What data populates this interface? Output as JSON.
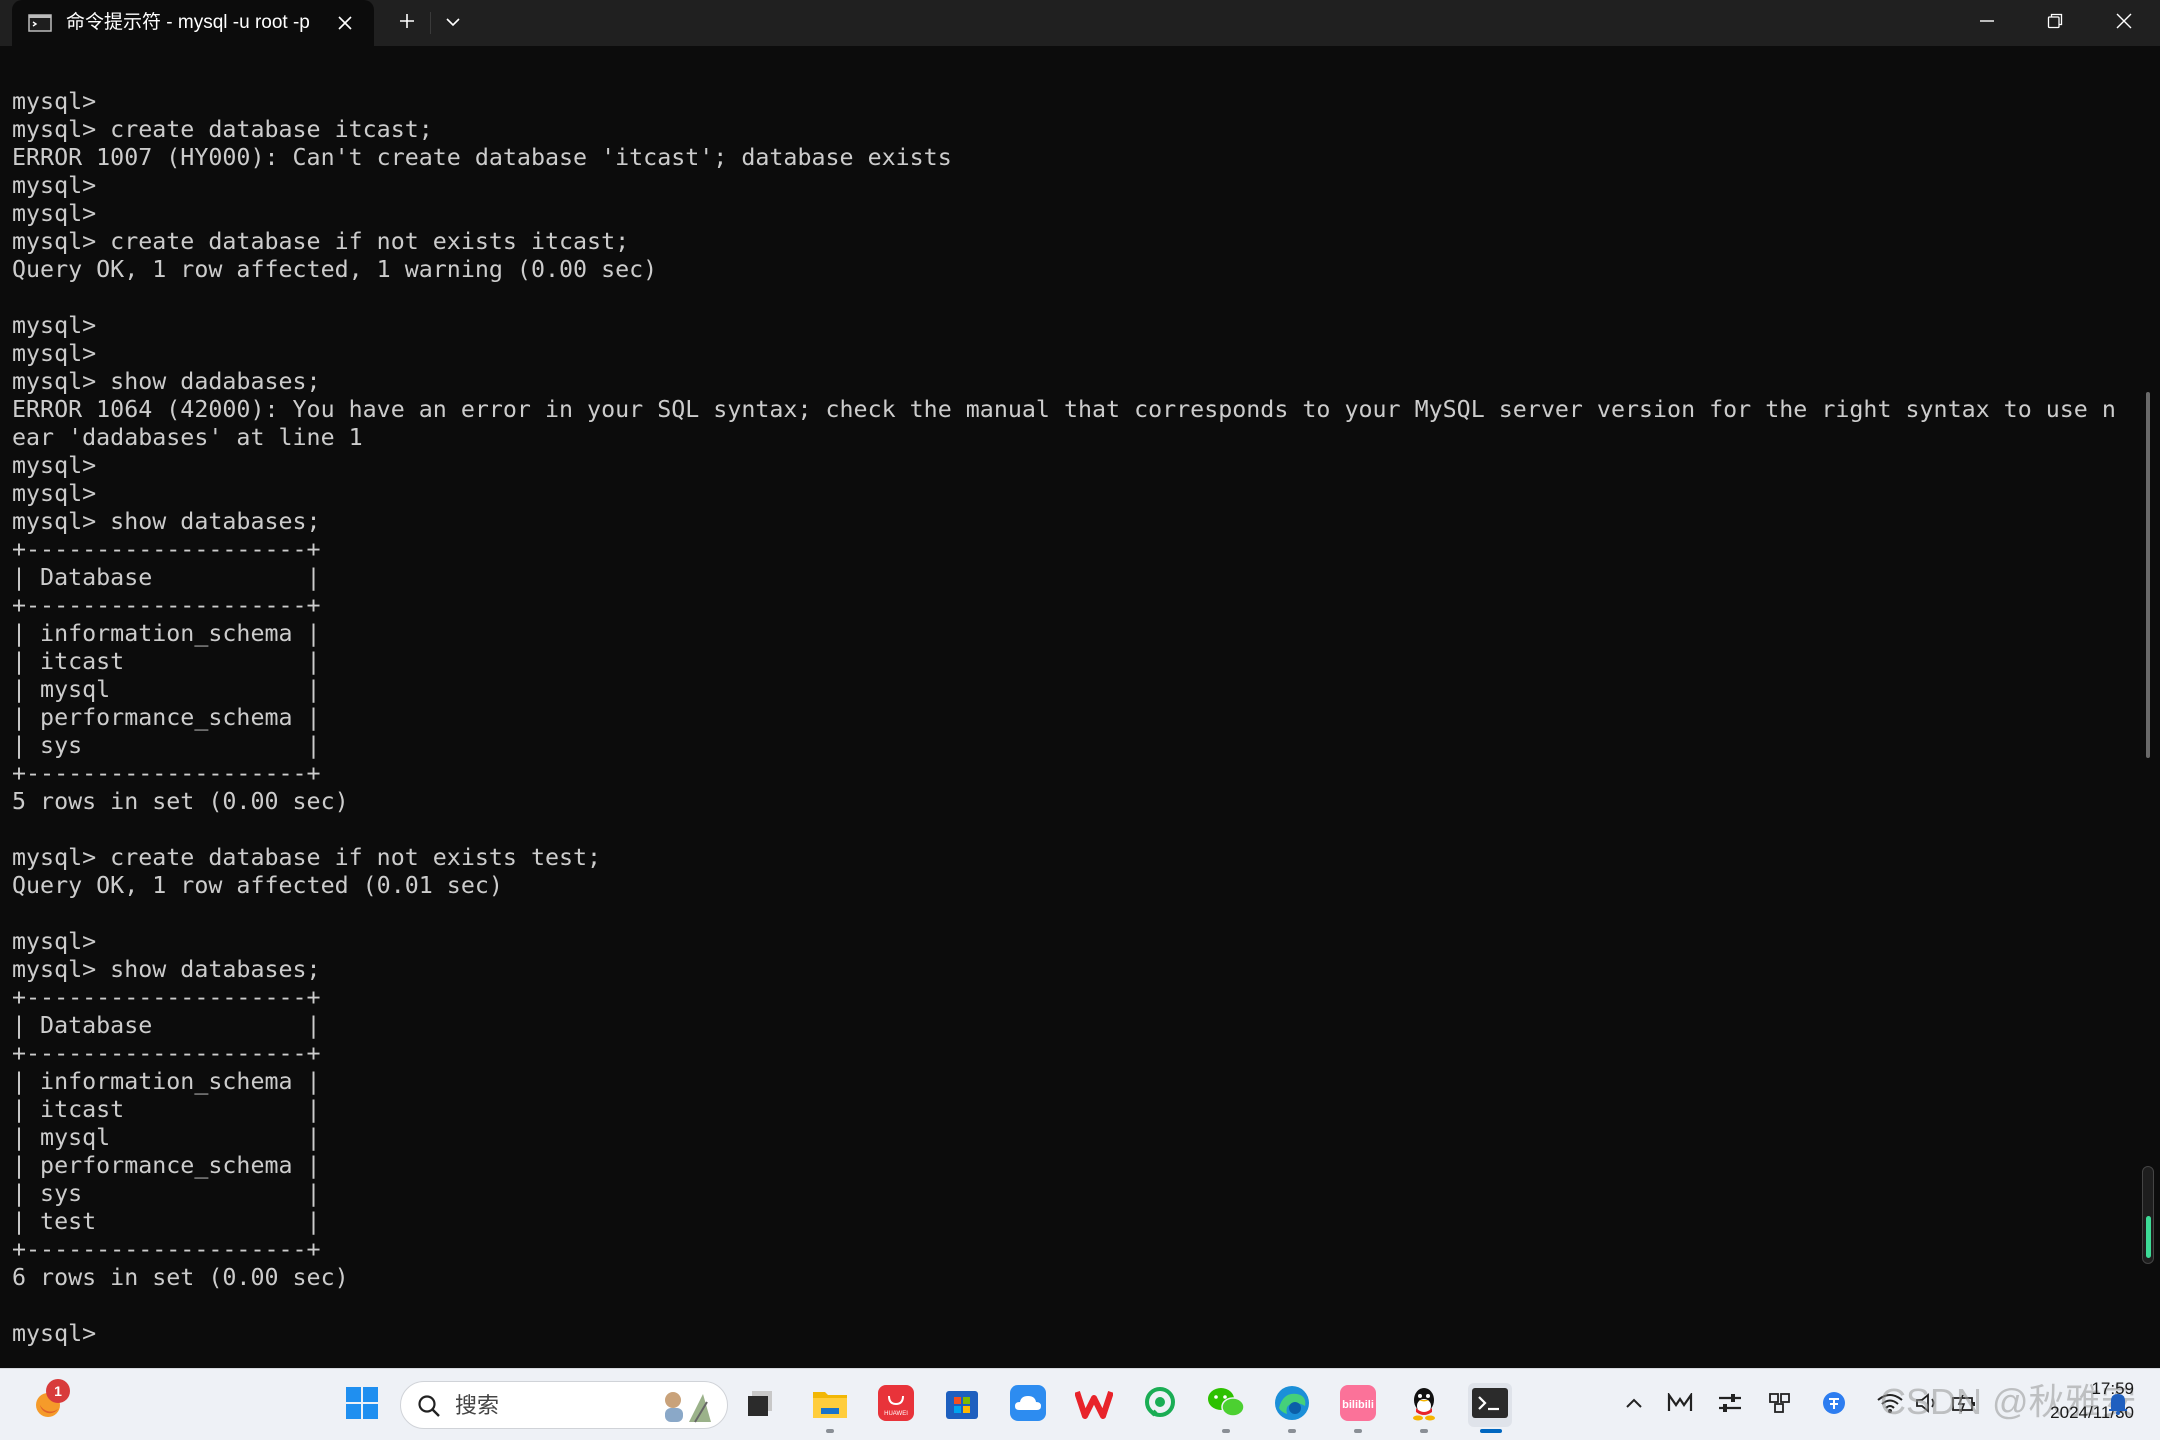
{
  "window": {
    "tab_title": "命令提示符 - mysql  -u root -p",
    "new_tab_icon": "plus-icon",
    "dropdown_icon": "chevron-down-icon",
    "controls": [
      "minimize-icon",
      "restore-icon",
      "close-icon"
    ]
  },
  "terminal": {
    "lines": [
      "mysql>",
      "mysql> create database itcast;",
      "ERROR 1007 (HY000): Can't create database 'itcast'; database exists",
      "mysql>",
      "mysql>",
      "mysql> create database if not exists itcast;",
      "Query OK, 1 row affected, 1 warning (0.00 sec)",
      "",
      "mysql>",
      "mysql>",
      "mysql> show dadabases;",
      "ERROR 1064 (42000): You have an error in your SQL syntax; check the manual that corresponds to your MySQL server version for the right syntax to use n",
      "ear 'dadabases' at line 1",
      "mysql>",
      "mysql>",
      "mysql> show databases;",
      "+--------------------+",
      "| Database           |",
      "+--------------------+",
      "| information_schema |",
      "| itcast             |",
      "| mysql              |",
      "| performance_schema |",
      "| sys                |",
      "+--------------------+",
      "5 rows in set (0.00 sec)",
      "",
      "mysql> create database if not exists test;",
      "Query OK, 1 row affected (0.01 sec)",
      "",
      "mysql>",
      "mysql> show databases;",
      "+--------------------+",
      "| Database           |",
      "+--------------------+",
      "| information_schema |",
      "| itcast             |",
      "| mysql              |",
      "| performance_schema |",
      "| sys                |",
      "| test               |",
      "+--------------------+",
      "6 rows in set (0.00 sec)",
      "",
      "mysql>"
    ],
    "colors": {
      "background": "#0c0c0c",
      "text": "#cccccc",
      "scroll_indicator": "#3ddc97"
    }
  },
  "taskbar": {
    "weather_badge": "1",
    "search_placeholder": "搜索",
    "apps": [
      {
        "name": "windows-start-icon"
      },
      {
        "name": "task-view-icon"
      },
      {
        "name": "file-explorer-icon"
      },
      {
        "name": "huawei-appgallery-icon",
        "label": "HUAWEI"
      },
      {
        "name": "microsoft-store-icon"
      },
      {
        "name": "cloud-drive-icon"
      },
      {
        "name": "wps-office-icon"
      },
      {
        "name": "green-chat-icon"
      },
      {
        "name": "wechat-icon"
      },
      {
        "name": "edge-browser-icon"
      },
      {
        "name": "bilibili-icon",
        "label": "bilibili"
      },
      {
        "name": "qq-icon"
      },
      {
        "name": "terminal-icon"
      }
    ],
    "tray": [
      "chevron-up-icon",
      "mail-icon",
      "sliders-icon",
      "blocks-icon",
      "ime-icon",
      "wifi-icon",
      "speaker-icon",
      "battery-icon",
      "notification-icon"
    ],
    "clock": {
      "time": "17:59",
      "date": "2024/11/30"
    },
    "watermark": "CSDN @秋雅安"
  }
}
